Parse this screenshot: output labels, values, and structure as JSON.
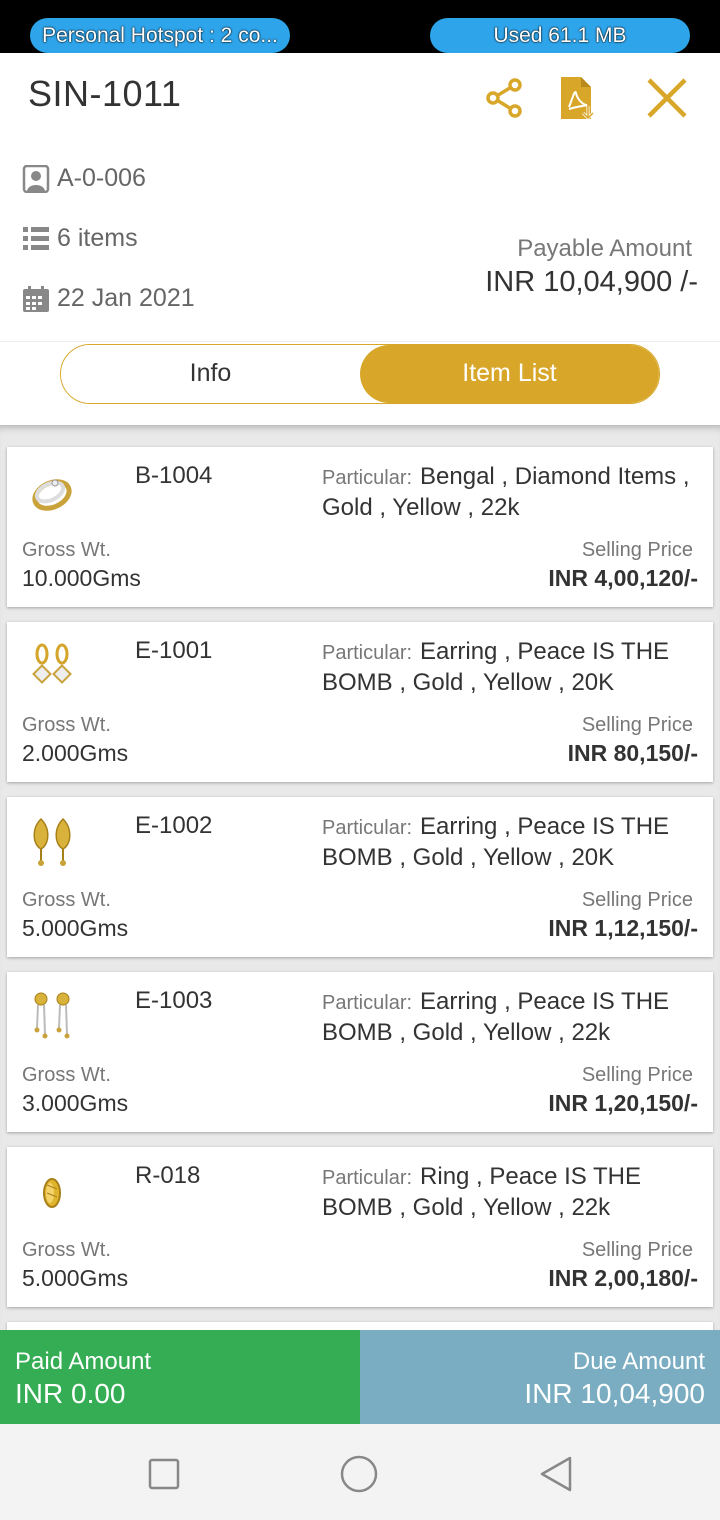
{
  "status_bar": {
    "hotspot": "Personal Hotspot : 2 co...",
    "data_used": "Used  61.1 MB"
  },
  "header": {
    "title": "SIN-1011",
    "share_icon": "share-icon",
    "pdf_icon": "pdf-download-icon",
    "close_icon": "close-icon",
    "accent_color": "#d8a72a"
  },
  "meta": {
    "account": "A-0-006",
    "items": "6 items",
    "date": "22 Jan 2021",
    "payable_label": "Payable Amount",
    "payable_value": "INR 10,04,900 /-"
  },
  "tabs": [
    {
      "label": "Info",
      "active": false
    },
    {
      "label": "Item List",
      "active": true
    }
  ],
  "labels": {
    "particular": "Particular:",
    "gross_wt": "Gross Wt.",
    "selling_price": "Selling Price"
  },
  "items": [
    {
      "code": "B-1004",
      "particular": "Bengal , Diamond Items , Gold , Yellow , 22k",
      "gross_wt": "10.000Gms",
      "price": "INR 4,00,120/-",
      "thumb": "ring-icon"
    },
    {
      "code": "E-1001",
      "particular": "Earring , Peace IS THE BOMB , Gold , Yellow , 20K",
      "gross_wt": "2.000Gms",
      "price": "INR 80,150/-",
      "thumb": "earring-icon"
    },
    {
      "code": "E-1002",
      "particular": "Earring , Peace IS THE BOMB , Gold , Yellow , 20K",
      "gross_wt": "5.000Gms",
      "price": "INR 1,12,150/-",
      "thumb": "earring-icon"
    },
    {
      "code": "E-1003",
      "particular": "Earring , Peace IS THE BOMB , Gold , Yellow , 22k",
      "gross_wt": "3.000Gms",
      "price": "INR 1,20,150/-",
      "thumb": "earring-icon"
    },
    {
      "code": "R-018",
      "particular": "Ring , Peace IS THE BOMB , Gold , Yellow , 22k",
      "gross_wt": "5.000Gms",
      "price": "INR 2,00,180/-",
      "thumb": "ring-icon"
    }
  ],
  "footer": {
    "paid_label": "Paid Amount",
    "paid_value": "INR 0.00",
    "due_label": "Due Amount",
    "due_value": "INR 10,04,900",
    "paid_color": "#35ad54",
    "due_color": "#7aadc1"
  },
  "navbar": {
    "recents_icon": "square-icon",
    "home_icon": "circle-icon",
    "back_icon": "back-triangle-icon"
  }
}
